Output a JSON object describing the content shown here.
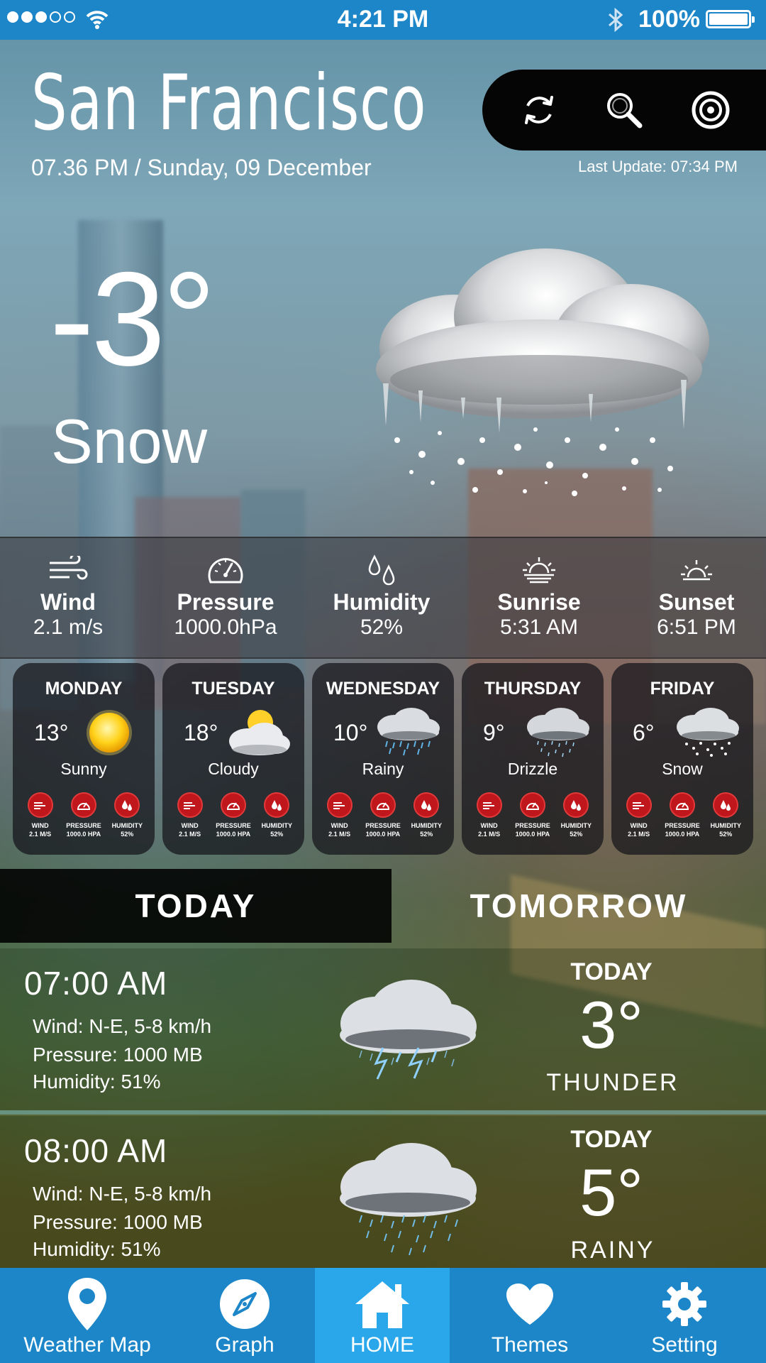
{
  "status_bar": {
    "time": "4:21 PM",
    "battery": "100%"
  },
  "header": {
    "city": "San Francisco",
    "datetime": "07.36 PM / Sunday, 09 December",
    "last_update": "Last Update: 07:34 PM",
    "toolbar_icons": [
      "refresh-icon",
      "search-icon",
      "location-target-icon"
    ]
  },
  "current": {
    "temperature": "-3°",
    "condition": "Snow"
  },
  "stats": [
    {
      "label": "Wind",
      "value": "2.1 m/s",
      "icon": "wind-icon"
    },
    {
      "label": "Pressure",
      "value": "1000.0hPa",
      "icon": "gauge-icon"
    },
    {
      "label": "Humidity",
      "value": "52%",
      "icon": "droplets-icon"
    },
    {
      "label": "Sunrise",
      "value": "5:31 AM",
      "icon": "sunrise-icon"
    },
    {
      "label": "Sunset",
      "value": "6:51 PM",
      "icon": "sunset-icon"
    }
  ],
  "forecast": [
    {
      "day": "MONDAY",
      "temp": "13°",
      "condition": "Sunny",
      "icon": "sun-icon",
      "mini": [
        {
          "label": "WIND",
          "value": "2.1 M/S"
        },
        {
          "label": "PRESSURE",
          "value": "1000.0 HPA"
        },
        {
          "label": "HUMIDITY",
          "value": "52%"
        }
      ]
    },
    {
      "day": "TUESDAY",
      "temp": "18°",
      "condition": "Cloudy",
      "icon": "partly-cloudy-icon",
      "mini": [
        {
          "label": "WIND",
          "value": "2.1 M/S"
        },
        {
          "label": "PRESSURE",
          "value": "1000.0 HPA"
        },
        {
          "label": "HUMIDITY",
          "value": "52%"
        }
      ]
    },
    {
      "day": "WEDNESDAY",
      "temp": "10°",
      "condition": "Rainy",
      "icon": "rain-cloud-icon",
      "mini": [
        {
          "label": "WIND",
          "value": "2.1 M/S"
        },
        {
          "label": "PRESSURE",
          "value": "1000.0 HPA"
        },
        {
          "label": "HUMIDITY",
          "value": "52%"
        }
      ]
    },
    {
      "day": "THURSDAY",
      "temp": "9°",
      "condition": "Drizzle",
      "icon": "drizzle-cloud-icon",
      "mini": [
        {
          "label": "WIND",
          "value": "2.1 M/S"
        },
        {
          "label": "PRESSURE",
          "value": "1000.0 HPA"
        },
        {
          "label": "HUMIDITY",
          "value": "52%"
        }
      ]
    },
    {
      "day": "FRIDAY",
      "temp": "6°",
      "condition": "Snow",
      "icon": "snow-cloud-icon",
      "mini": [
        {
          "label": "WIND",
          "value": "2.1 M/S"
        },
        {
          "label": "PRESSURE",
          "value": "1000.0 HPA"
        },
        {
          "label": "HUMIDITY",
          "value": "52%"
        }
      ]
    }
  ],
  "tabs": {
    "today": "TODAY",
    "tomorrow": "TOMORROW",
    "active": "today"
  },
  "hourly": [
    {
      "time": "07:00 AM",
      "wind": "Wind: N-E, 5-8 km/h",
      "pressure": "Pressure: 1000 MB",
      "humidity": "Humidity: 51%",
      "day": "TODAY",
      "temp": "3°",
      "condition": "THUNDER",
      "icon": "thunder-cloud-icon"
    },
    {
      "time": "08:00 AM",
      "wind": "Wind: N-E, 5-8 km/h",
      "pressure": "Pressure: 1000 MB",
      "humidity": "Humidity: 51%",
      "day": "TODAY",
      "temp": "5°",
      "condition": "RAINY",
      "icon": "rain-cloud-icon"
    }
  ],
  "nav": [
    {
      "label": "Weather Map",
      "icon": "map-pin-icon"
    },
    {
      "label": "Graph",
      "icon": "compass-icon"
    },
    {
      "label": "HOME",
      "icon": "home-icon",
      "active": true
    },
    {
      "label": "Themes",
      "icon": "heart-icon"
    },
    {
      "label": "Setting",
      "icon": "gear-icon"
    }
  ],
  "colors": {
    "primary_blue": "#1c86c8",
    "active_blue": "#2aa7ea",
    "badge_red": "#c0171d"
  }
}
